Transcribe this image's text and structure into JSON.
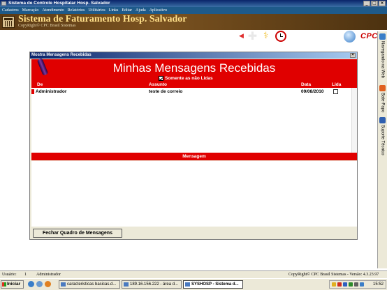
{
  "window": {
    "title": "Sistema de Controle Hospitalar Hosp. Salvador",
    "min_label": "_",
    "max_label": "□",
    "close_label": "×"
  },
  "menu": [
    "Cadastros",
    "Marcação",
    "Atendimento",
    "Relatórios",
    "Utilitários",
    "Links",
    "Editar",
    "Ajuda",
    "Aplicativo"
  ],
  "banner": {
    "title": "Sistema de Faturamento Hosp. Salvador",
    "copyright": "CopyRight© CPC Brasil Sistemas",
    "logo_text": "CPC"
  },
  "toolbar_icons": [
    "back-arrow-icon",
    "red-cross-icon",
    "caduceus-icon",
    "clock-icon",
    "documents-icon",
    "eye-icon",
    "web-globe-icon"
  ],
  "side_tabs": [
    {
      "label": "Navegando na Web",
      "icon_color": "#3a7ec8"
    },
    {
      "label": "Bate-Papo",
      "icon_color": "#e06020"
    },
    {
      "label": "Suporte Técnico",
      "icon_color": "#3060b0"
    }
  ],
  "dialog": {
    "title": "Mostra Mensagens Recebidas",
    "heading": "Minhas Mensagens Recebidas",
    "filter_label": "Somente as não Lidas",
    "filter_checked": true,
    "columns": {
      "from": "De",
      "subject": "Assunto",
      "date": "Data",
      "read": "Lida"
    },
    "messages": [
      {
        "from": "Administrador",
        "subject": "teste de correio",
        "date": "09/08/2010",
        "read": false
      }
    ],
    "message_section_label": "Mensagem",
    "close_button": "Fechar Quadro de Mensagens"
  },
  "status": {
    "user_label": "Usuário:",
    "user_id": "1",
    "user_name": "Administrador",
    "version": "CopyRight© CPC Brasil Sistemas - Versão: 4.3.23.97"
  },
  "taskbar": {
    "start": "Iniciar",
    "tasks": [
      {
        "label": "caracteristicas basicas.d...",
        "active": false
      },
      {
        "label": "189.16.156.222 - área d...",
        "active": false
      },
      {
        "label": "SYSHOSP - Sistema d...",
        "active": true
      }
    ],
    "time": "15:52"
  },
  "colors": {
    "accent_red": "#e00000",
    "title_blue": "#0a246a"
  }
}
